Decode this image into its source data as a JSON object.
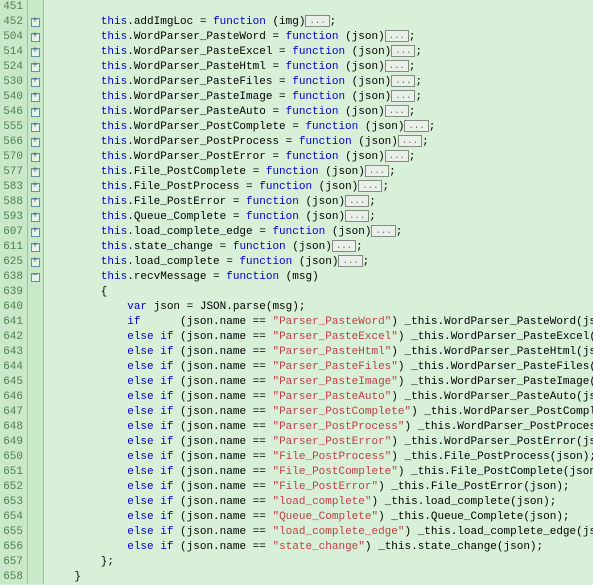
{
  "lineNumbers": [
    "451",
    "452",
    "504",
    "514",
    "524",
    "530",
    "540",
    "546",
    "555",
    "566",
    "570",
    "577",
    "583",
    "588",
    "593",
    "607",
    "611",
    "625",
    "638",
    "639",
    "640",
    "641",
    "642",
    "643",
    "644",
    "645",
    "646",
    "647",
    "648",
    "649",
    "650",
    "651",
    "652",
    "653",
    "654",
    "655",
    "656",
    "657",
    "658"
  ],
  "folds": [
    "",
    "+",
    "+",
    "+",
    "+",
    "+",
    "+",
    "+",
    "+",
    "+",
    "+",
    "+",
    "+",
    "+",
    "+",
    "+",
    "+",
    "+",
    "-",
    "",
    "",
    "",
    "",
    "",
    "",
    "",
    "",
    "",
    "",
    "",
    "",
    "",
    "",
    "",
    "",
    "",
    "",
    "",
    ""
  ],
  "code": {
    "l451": "",
    "kw_this": "this",
    "kw_function": "function",
    "kw_var": "var",
    "kw_if": "if",
    "kw_else_if": "else if",
    "ellipsis": "...",
    "methods": [
      {
        "name": "addImgLoc",
        "arg": "img"
      },
      {
        "name": "WordParser_PasteWord",
        "arg": "json"
      },
      {
        "name": "WordParser_PasteExcel",
        "arg": "json"
      },
      {
        "name": "WordParser_PasteHtml",
        "arg": "json"
      },
      {
        "name": "WordParser_PasteFiles",
        "arg": "json"
      },
      {
        "name": "WordParser_PasteImage",
        "arg": "json"
      },
      {
        "name": "WordParser_PasteAuto",
        "arg": "json"
      },
      {
        "name": "WordParser_PostComplete",
        "arg": "json"
      },
      {
        "name": "WordParser_PostProcess",
        "arg": "json"
      },
      {
        "name": "WordParser_PostError",
        "arg": "json"
      },
      {
        "name": "File_PostComplete",
        "arg": "json"
      },
      {
        "name": "File_PostProcess",
        "arg": "json"
      },
      {
        "name": "File_PostError",
        "arg": "json"
      },
      {
        "name": "Queue_Complete",
        "arg": "json"
      },
      {
        "name": "load_complete_edge",
        "arg": "json"
      },
      {
        "name": "state_change",
        "arg": "json"
      },
      {
        "name": "load_complete",
        "arg": "json"
      }
    ],
    "recvMethod": {
      "name": "recvMessage",
      "arg": "msg"
    },
    "l639": "        {",
    "parse_lhs": "            var",
    "parse_rhs": " json = JSON.parse(msg);",
    "dispatch": [
      {
        "cond": "if     ",
        "str": "\"Parser_PasteWord\"",
        "call": "_this.WordParser_PasteWord(json);"
      },
      {
        "cond": "else if",
        "str": "\"Parser_PasteExcel\"",
        "call": "_this.WordParser_PasteExcel(json);"
      },
      {
        "cond": "else if",
        "str": "\"Parser_PasteHtml\"",
        "call": "_this.WordParser_PasteHtml(json);"
      },
      {
        "cond": "else if",
        "str": "\"Parser_PasteFiles\"",
        "call": "_this.WordParser_PasteFiles(json);"
      },
      {
        "cond": "else if",
        "str": "\"Parser_PasteImage\"",
        "call": "_this.WordParser_PasteImage(json);"
      },
      {
        "cond": "else if",
        "str": "\"Parser_PasteAuto\"",
        "call": "_this.WordParser_PasteAuto(json);"
      },
      {
        "cond": "else if",
        "str": "\"Parser_PostComplete\"",
        "call": "_this.WordParser_PostComplete(json);"
      },
      {
        "cond": "else if",
        "str": "\"Parser_PostProcess\"",
        "call": "_this.WordParser_PostProcess(json);"
      },
      {
        "cond": "else if",
        "str": "\"Parser_PostError\"",
        "call": "_this.WordParser_PostError(json);"
      },
      {
        "cond": "else if",
        "str": "\"File_PostProcess\"",
        "call": "_this.File_PostProcess(json);"
      },
      {
        "cond": "else if",
        "str": "\"File_PostComplete\"",
        "call": "_this.File_PostComplete(json);"
      },
      {
        "cond": "else if",
        "str": "\"File_PostError\"",
        "call": "_this.File_PostError(json);"
      },
      {
        "cond": "else if",
        "str": "\"load_complete\"",
        "call": "_this.load_complete(json);"
      },
      {
        "cond": "else if",
        "str": "\"Queue_Complete\"",
        "call": "_this.Queue_Complete(json);"
      },
      {
        "cond": "else if",
        "str": "\"load_complete_edge\"",
        "call": "_this.load_complete_edge(json);"
      },
      {
        "cond": "else if",
        "str": "\"state_change\"",
        "call": "_this.state_change(json);"
      }
    ],
    "l657": "        };",
    "l658": "    }"
  }
}
